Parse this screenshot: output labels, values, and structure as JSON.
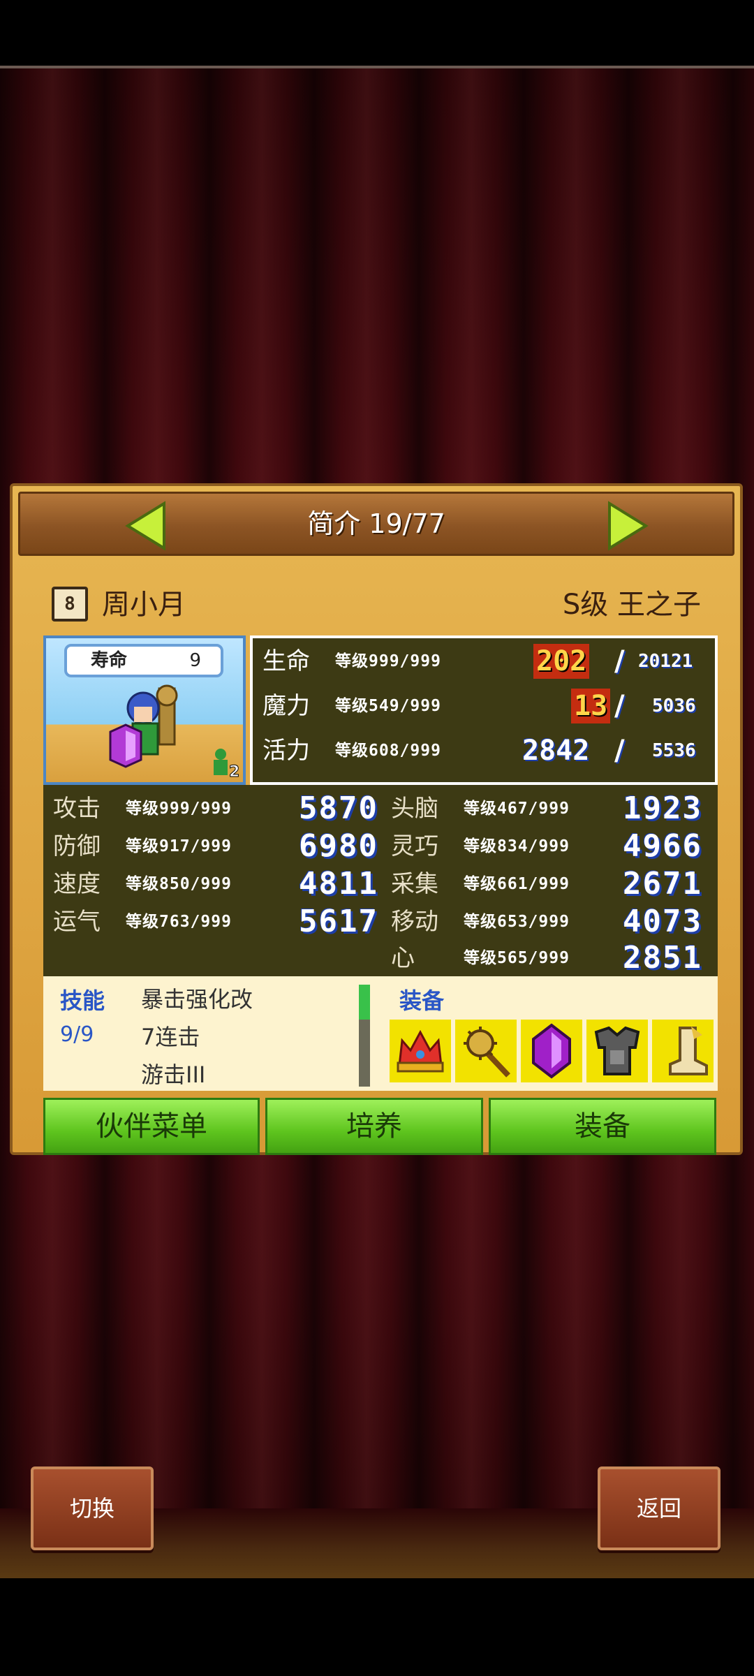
{
  "header": {
    "title": "简介 19/77"
  },
  "character": {
    "level_badge": "8",
    "name": "周小月",
    "class": "S级 王之子",
    "lifespan_label": "寿命",
    "lifespan_value": "9",
    "partner_count": "2"
  },
  "vitals": [
    {
      "label": "生命",
      "grade": "等级999/999",
      "current": "202",
      "max": "20121"
    },
    {
      "label": "魔力",
      "grade": "等级549/999",
      "current": "13",
      "max": "5036"
    },
    {
      "label": "活力",
      "grade": "等级608/999",
      "current": "2842",
      "max": "5536"
    }
  ],
  "attributes_left": [
    {
      "label": "攻击",
      "grade": "等级999/999",
      "value": "5870"
    },
    {
      "label": "防御",
      "grade": "等级917/999",
      "value": "6980"
    },
    {
      "label": "速度",
      "grade": "等级850/999",
      "value": "4811"
    },
    {
      "label": "运气",
      "grade": "等级763/999",
      "value": "5617"
    }
  ],
  "attributes_right": [
    {
      "label": "头脑",
      "grade": "等级467/999",
      "value": "1923"
    },
    {
      "label": "灵巧",
      "grade": "等级834/999",
      "value": "4966"
    },
    {
      "label": "采集",
      "grade": "等级661/999",
      "value": "2671"
    },
    {
      "label": "移动",
      "grade": "等级653/999",
      "value": "4073"
    },
    {
      "label": "心",
      "grade": "等级565/999",
      "value": "2851"
    }
  ],
  "skills": {
    "heading": "技能",
    "count": "9/9",
    "items": [
      "暴击强化改",
      "7连击",
      "游击III"
    ]
  },
  "equipment": {
    "heading": "装备",
    "slots": [
      "crown-icon",
      "mace-icon",
      "gem-icon",
      "armor-icon",
      "boot-icon"
    ]
  },
  "buttons": {
    "partner_menu": "伙伴菜单",
    "train": "培养",
    "equip": "装备"
  },
  "bottom": {
    "switch": "切换",
    "back": "返回"
  }
}
